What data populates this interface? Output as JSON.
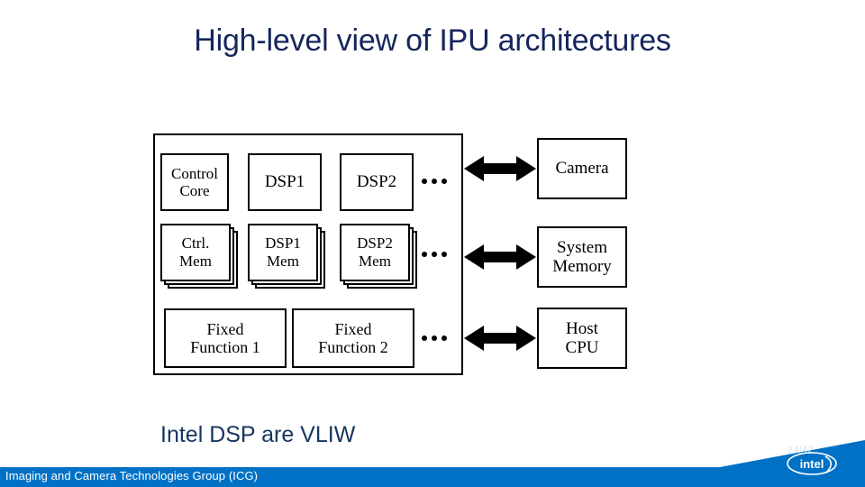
{
  "slide": {
    "title": "High-level view of IPU architectures",
    "caption": "Intel DSP  are  VLIW"
  },
  "diagram": {
    "name": "ipu-architecture-block-diagram",
    "compute_row": [
      {
        "label": "Control\nCore",
        "line1": "Control",
        "line2": "Core"
      },
      {
        "label": "DSP1",
        "line1": "DSP1",
        "line2": ""
      },
      {
        "label": "DSP2",
        "line1": "DSP2",
        "line2": ""
      }
    ],
    "memory_row": [
      {
        "line1": "Ctrl.",
        "line2": "Mem"
      },
      {
        "line1": "DSP1",
        "line2": "Mem"
      },
      {
        "line1": "DSP2",
        "line2": "Mem"
      }
    ],
    "fixed_function_row": [
      {
        "line1": "Fixed",
        "line2": "Function 1"
      },
      {
        "line1": "Fixed",
        "line2": "Function 2"
      }
    ],
    "external_blocks": [
      {
        "line1": "Camera",
        "line2": ""
      },
      {
        "line1": "System",
        "line2": "Memory"
      },
      {
        "line1": "Host",
        "line2": "CPU"
      }
    ],
    "ellipsis": "•••",
    "connector": "double-headed-arrow",
    "connector_count": 3,
    "colors": {
      "stroke": "#000000",
      "fill": "#ffffff"
    }
  },
  "footer": {
    "text": "Imaging and Camera Technologies Group (ICG)",
    "slide_number": "24/42",
    "logo_text": "intel",
    "bar_color": "#0071c5",
    "text_color": "#ffffff"
  },
  "theme": {
    "title_color": "#16265c",
    "caption_color": "#16355e",
    "background": "#ffffff"
  }
}
